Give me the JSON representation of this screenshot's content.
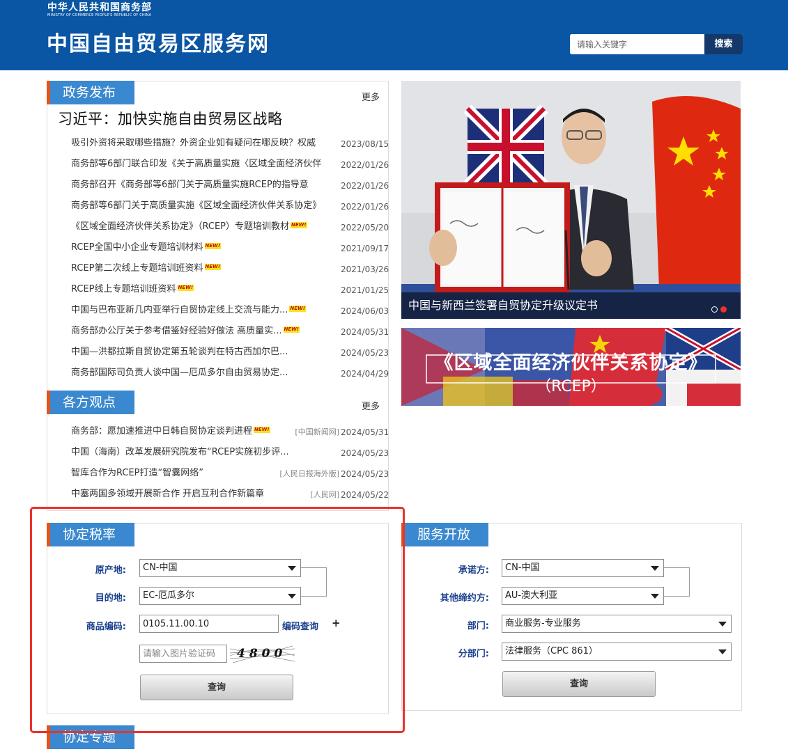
{
  "header": {
    "ministry_cn": "中华人民共和国商务部",
    "ministry_en": "MINISTRY OF COMMERCE PEOPLE'S REPUBLIC OF CHINA",
    "site_title": "中国自由贸易区服务网",
    "search_placeholder": "请输入关键字",
    "search_button": "搜索"
  },
  "news": {
    "title": "政务发布",
    "more": "更多",
    "headline": "习近平：加快实施自由贸易区战略",
    "items": [
      {
        "text": "吸引外资将采取哪些措施？外资企业如有疑问在哪反映？权威",
        "date": "2023/08/15",
        "new": ""
      },
      {
        "text": "商务部等6部门联合印发《关于高质量实施〈区域全面经济伙伴",
        "date": "2022/01/26",
        "new": ""
      },
      {
        "text": "商务部召开《商务部等6部门关于高质量实施RCEP的指导意",
        "date": "2022/01/26",
        "new": ""
      },
      {
        "text": "商务部等6部门关于高质量实施《区域全面经济伙伴关系协定》",
        "date": "2022/01/26",
        "new": ""
      },
      {
        "text": "《区域全面经济伙伴关系协定》（RCEP）专题培训教材",
        "date": "2022/05/20",
        "new": "NEW!"
      },
      {
        "text": "RCEP全国中小企业专题培训材料",
        "date": "2021/09/17",
        "new": "NEW!"
      },
      {
        "text": "RCEP第二次线上专题培训班资料",
        "date": "2021/03/26",
        "new": "NEW!"
      },
      {
        "text": "RCEP线上专题培训班资料",
        "date": "2021/01/25",
        "new": "NEW!"
      },
      {
        "text": "中国与巴布亚新几内亚举行自贸协定线上交流与能力...",
        "date": "2024/06/03",
        "new": "NEW!"
      },
      {
        "text": "商务部办公厅关于参考借鉴好经验好做法 高质量实...",
        "date": "2024/05/31",
        "new": "NEW!"
      },
      {
        "text": "中国—洪都拉斯自贸协定第五轮谈判在特古西加尔巴...",
        "date": "2024/05/23",
        "new": ""
      },
      {
        "text": "商务部国际司负责人谈中国—厄瓜多尔自由贸易协定...",
        "date": "2024/04/29",
        "new": ""
      }
    ]
  },
  "views": {
    "title": "各方观点",
    "more": "更多",
    "items": [
      {
        "text": "商务部：愿加速推进中日韩自贸协定谈判进程",
        "new": "NEW!",
        "source": "[中国新闻网]",
        "date": "2024/05/31"
      },
      {
        "text": "中国（海南）改革发展研究院发布“RCEP实施初步评...",
        "new": "",
        "source": "",
        "date": "2024/05/23"
      },
      {
        "text": "智库合作为RCEP打造“智囊网络”",
        "new": "",
        "source": "[人民日报海外版]",
        "date": "2024/05/23"
      },
      {
        "text": "中塞两国多领域开展新合作 开启互利合作新篇章",
        "new": "",
        "source": "[人民网]",
        "date": "2024/05/22"
      }
    ]
  },
  "slider": {
    "caption": "中国与新西兰签署自贸协定升级议定书",
    "total": 2,
    "active": 2
  },
  "banner": {
    "title": "《区域全面经济伙伴关系协定》",
    "subtitle": "（RCEP）"
  },
  "tariff": {
    "title": "协定税率",
    "origin_label": "原产地:",
    "origin_value": "CN-中国",
    "dest_label": "目的地:",
    "dest_value": "EC-厄瓜多尔",
    "code_label": "商品编码:",
    "code_value": "0105.11.00.10",
    "code_link": "编码查询",
    "plus": "+",
    "captcha_placeholder": "请输入图片验证码",
    "captcha_text": "4800",
    "query_button": "查询"
  },
  "service": {
    "title": "服务开放",
    "promiser_label": "承诺方:",
    "promiser_value": "CN-中国",
    "other_label": "其他缔约方:",
    "other_value": "AU-澳大利亚",
    "dept_label": "部门:",
    "dept_value": "商业服务-专业服务",
    "subdept_label": "分部门:",
    "subdept_value": "法律服务（CPC 861）",
    "query_button": "查询"
  },
  "topics": {
    "title": "协定专题"
  },
  "colors": {
    "header_bg": "#0a56a4",
    "section_bg": "#3a88cf",
    "section_accent": "#e0551c",
    "highlight": "#e8332a"
  }
}
